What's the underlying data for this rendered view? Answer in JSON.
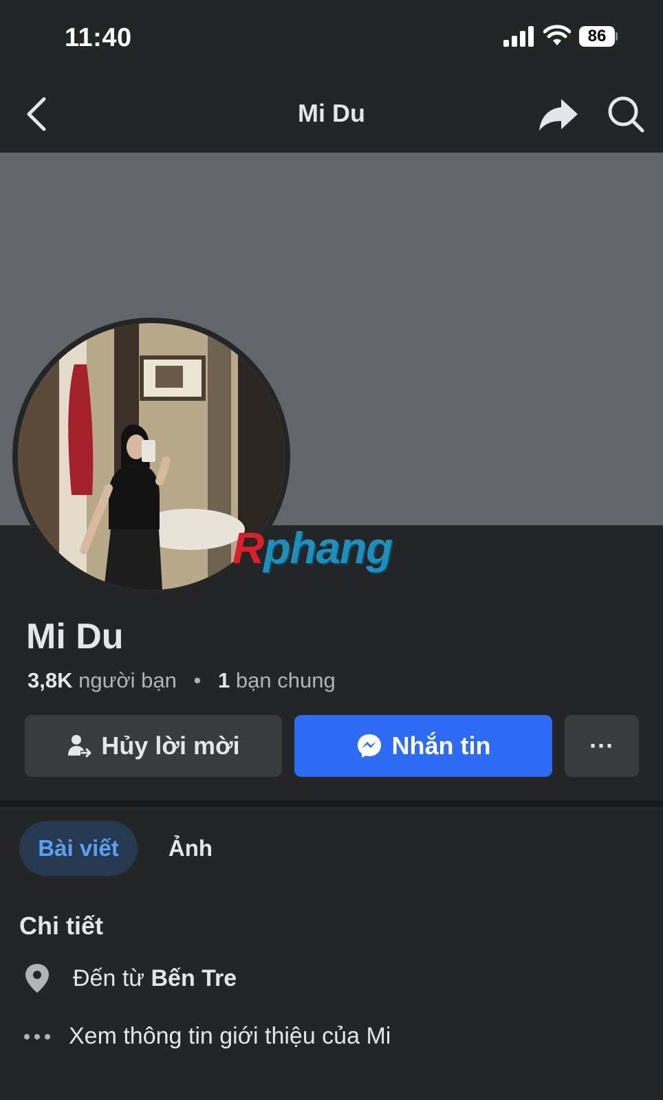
{
  "status_bar": {
    "time": "11:40",
    "battery": "86"
  },
  "nav": {
    "title": "Mi Du",
    "icons": [
      "chevron-left-icon",
      "share-icon",
      "search-icon"
    ]
  },
  "watermark": {
    "r": "R",
    "rest": "phang"
  },
  "profile": {
    "name": "Mi Du",
    "friends_count": "3,8K",
    "friends_label": "người bạn",
    "separator": "•",
    "mutual_count": "1",
    "mutual_label": "bạn chung"
  },
  "actions": {
    "cancel_label": "Hủy lời mời",
    "message_label": "Nhắn tin",
    "more_label": "···"
  },
  "tabs": [
    {
      "label": "Bài viết",
      "active": true
    },
    {
      "label": "Ảnh",
      "active": false
    }
  ],
  "details": {
    "title": "Chi tiết",
    "from_prefix": "Đến từ ",
    "from_place": "Bến Tre",
    "about_label": "Xem thông tin giới thiệu của Mi"
  },
  "colors": {
    "background": "#242526",
    "cover": "#626569",
    "primary": "#2e6bf4",
    "secondary_button": "#3a3b3c",
    "active_tab_bg": "#263951",
    "active_tab_text": "#5aa0f2"
  }
}
